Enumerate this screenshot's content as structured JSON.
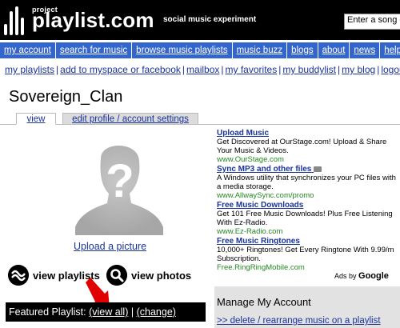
{
  "header": {
    "logo_small": "project",
    "logo_main": "playlist.com",
    "tagline": "social music experiment",
    "search_placeholder": "Enter a song or artist"
  },
  "nav": {
    "items": [
      "my account",
      "search for music",
      "browse music playlists",
      "music buzz",
      "blogs",
      "about",
      "news",
      "help"
    ]
  },
  "sublinks": {
    "items": [
      "my playlists",
      "add to myspace or facebook",
      "mailbox",
      "my favorites",
      "my buddylist",
      "my blog",
      "logout"
    ]
  },
  "profile": {
    "username": "Sovereign_Clan",
    "tabs": [
      "view",
      "edit profile / account settings"
    ],
    "upload_label": "Upload a picture",
    "view_playlists_label": "view playlists",
    "view_photos_label": "view photos"
  },
  "featured": {
    "prefix": "Featured Playlist:",
    "view_all": "(view all)",
    "separator": "|",
    "change": "(change)"
  },
  "ads": [
    {
      "title": "Upload Music",
      "text": "Get Discovered at OurStage.com! Upload & Share Your Music & Videos.",
      "url": "www.OurStage.com"
    },
    {
      "title": "Sync MP3 and other files",
      "text": "A Windows utility that synchronizes your PC files with a media storage.",
      "url": "www.AllwaySync.com/promo"
    },
    {
      "title": "Free Music Downloads",
      "text": "Get 101 Free Music Downloads! Plus Free Listening With Ez-Radio.",
      "url": "www.Ez-Radio.com"
    },
    {
      "title": "Free Music Ringtones",
      "text": "10,000+ Ringtones! Get Every Ringtone With 9.99/m Subscription.",
      "url": "Free.RingRingMobile.com"
    }
  ],
  "ads_by": {
    "prefix": "Ads by",
    "brand": "Google"
  },
  "manage": {
    "title": "Manage My Account",
    "link": ">> delete / rearrange music on a playlist"
  },
  "colors": {
    "nav_bg": "#3366cc",
    "link": "#1a3399",
    "arrow": "#e00000",
    "ad_url": "#228822"
  }
}
